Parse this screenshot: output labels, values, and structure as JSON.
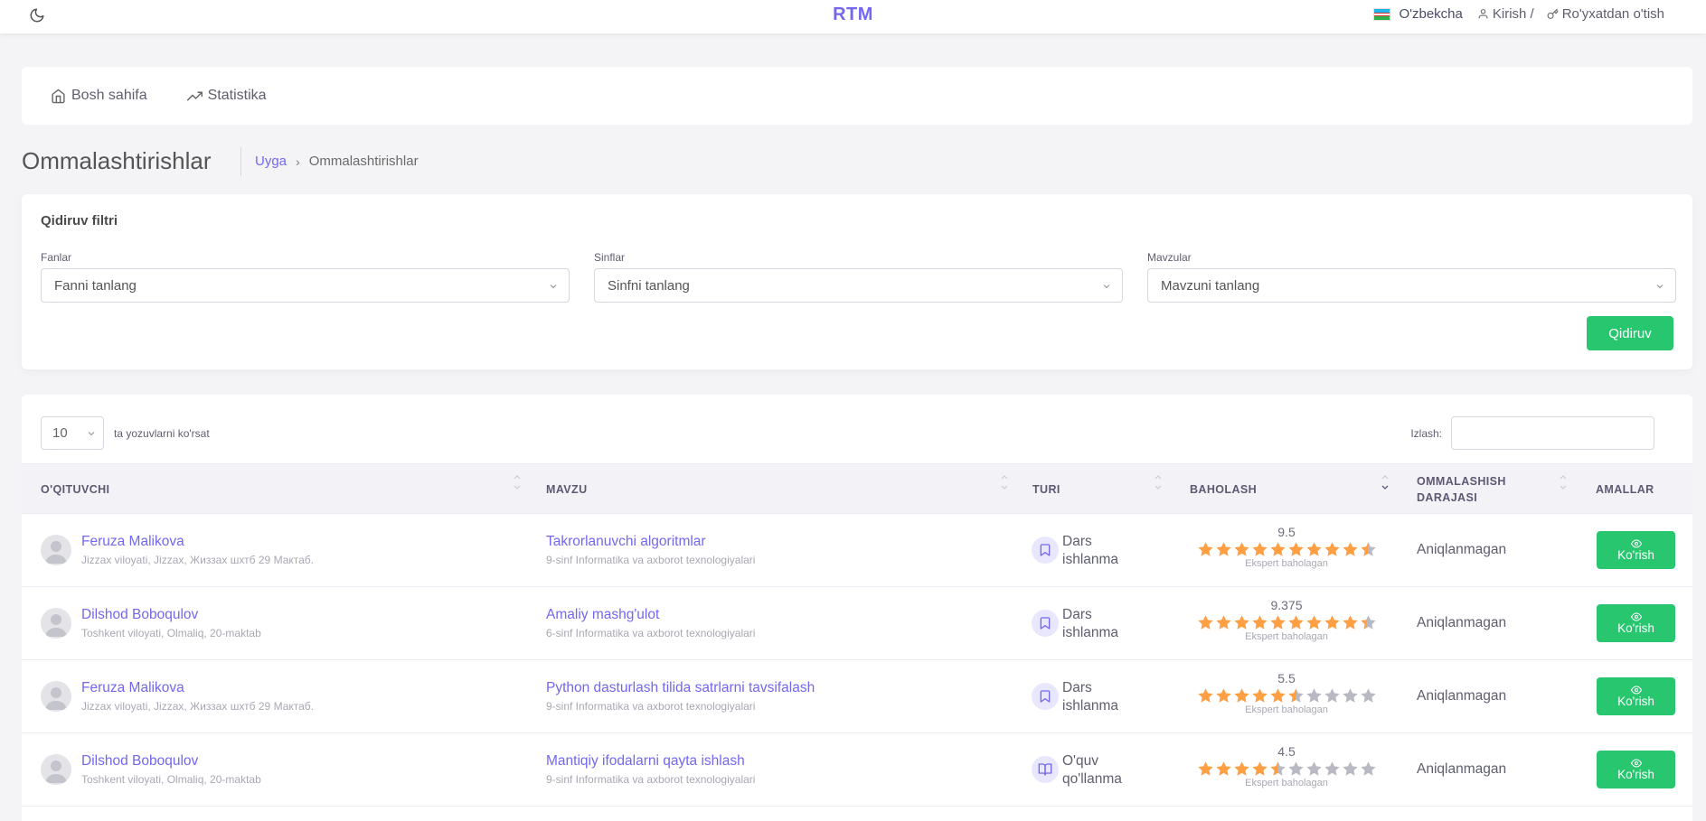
{
  "topbar": {
    "brand": "RTM",
    "language": "O'zbekcha",
    "login": "Kirish /",
    "register": "Ro'yxatdan o'tish"
  },
  "nav": {
    "items": [
      {
        "label": "Bosh sahifa",
        "icon": "home-icon"
      },
      {
        "label": "Statistika",
        "icon": "trending-up-icon"
      }
    ]
  },
  "page": {
    "title": "Ommalashtirishlar",
    "breadcrumb_home": "Uyga",
    "breadcrumb_current": "Ommalashtirishlar"
  },
  "filter": {
    "title": "Qidiruv filtri",
    "subjects_label": "Fanlar",
    "subjects_value": "Fanni tanlang",
    "classes_label": "Sinflar",
    "classes_value": "Sinfni tanlang",
    "topics_label": "Mavzular",
    "topics_value": "Mavzuni tanlang",
    "search_button": "Qidiruv"
  },
  "table": {
    "page_length": "10",
    "page_length_text": "ta yozuvlarni ko'rsat",
    "search_label": "Izlash:",
    "headers": {
      "teacher": "O'QITUVCHI",
      "topic": "MAVZU",
      "type": "TURI",
      "rating": "BAHOLASH",
      "degree_line1": "OMMALASHISH",
      "degree_line2": "DARAJASI",
      "actions": "AMALLAR"
    },
    "rows": [
      {
        "teacher": "Feruza Malikova",
        "teacher_sub": "Jizzax viloyati, Jizzax, Жиззах шхтб 29 Мактаб.",
        "topic": "Takrorlanuvchi algoritmlar",
        "topic_sub": "9-sinf Informatika va axborot texnologiyalari",
        "type_line1": "Dars",
        "type_line2": "ishlanma",
        "type_icon": "bookmark-icon",
        "rating_value": "9.5",
        "rating": 9.5,
        "rating_label": "Ekspert baholagan",
        "degree": "Aniqlanmagan",
        "action": "Ko'rish"
      },
      {
        "teacher": "Dilshod Boboqulov",
        "teacher_sub": "Toshkent viloyati, Olmaliq, 20-maktab",
        "topic": "Amaliy mashg'ulot",
        "topic_sub": "6-sinf Informatika va axborot texnologiyalari",
        "type_line1": "Dars",
        "type_line2": "ishlanma",
        "type_icon": "bookmark-icon",
        "rating_value": "9.375",
        "rating": 9.375,
        "rating_label": "Ekspert baholagan",
        "degree": "Aniqlanmagan",
        "action": "Ko'rish"
      },
      {
        "teacher": "Feruza Malikova",
        "teacher_sub": "Jizzax viloyati, Jizzax, Жиззах шхтб 29 Мактаб.",
        "topic": "Python dasturlash tilida satrlarni tavsifalash",
        "topic_sub": "9-sinf Informatika va axborot texnologiyalari",
        "type_line1": "Dars",
        "type_line2": "ishlanma",
        "type_icon": "bookmark-icon",
        "rating_value": "5.5",
        "rating": 5.5,
        "rating_label": "Ekspert baholagan",
        "degree": "Aniqlanmagan",
        "action": "Ko'rish"
      },
      {
        "teacher": "Dilshod Boboqulov",
        "teacher_sub": "Toshkent viloyati, Olmaliq, 20-maktab",
        "topic": "Mantiqiy ifodalarni qayta ishlash",
        "topic_sub": "9-sinf Informatika va axborot texnologiyalari",
        "type_line1": "O'quv",
        "type_line2": "qo'llanma",
        "type_icon": "book-open-icon",
        "rating_value": "4.5",
        "rating": 4.5,
        "rating_label": "Ekspert baholagan",
        "degree": "Aniqlanmagan",
        "action": "Ko'rish"
      }
    ]
  },
  "colors": {
    "accent": "#7367f0",
    "success": "#28c76f",
    "star_filled": "#ff9f43",
    "star_empty": "#b9b9c3"
  }
}
